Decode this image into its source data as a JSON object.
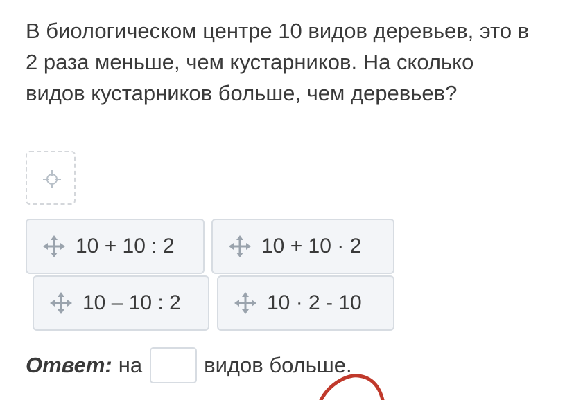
{
  "question": {
    "text": "В биологическом центре 10 видов деревьев, это в 2 раза меньше, чем кустарников. На сколько видов кустарников больше, чем деревьев?"
  },
  "dropzone": {
    "icon": "target-crosshair-icon"
  },
  "options": [
    {
      "expression": "10 + 10 : 2",
      "icon": "move-arrows-icon"
    },
    {
      "expression": "10 + 10 · 2",
      "icon": "move-arrows-icon"
    },
    {
      "expression": "10 – 10 : 2",
      "icon": "move-arrows-icon"
    },
    {
      "expression": "10 · 2 - 10",
      "icon": "move-arrows-icon"
    }
  ],
  "answer": {
    "label": "Ответ:",
    "prefix": "на",
    "value": "",
    "suffix": "видов больше."
  },
  "colors": {
    "text": "#3a3a3a",
    "tile_bg": "#f3f5f8",
    "tile_border": "#d7dce2",
    "icon": "#9aa3ad",
    "pen_mark": "#c0392b"
  }
}
